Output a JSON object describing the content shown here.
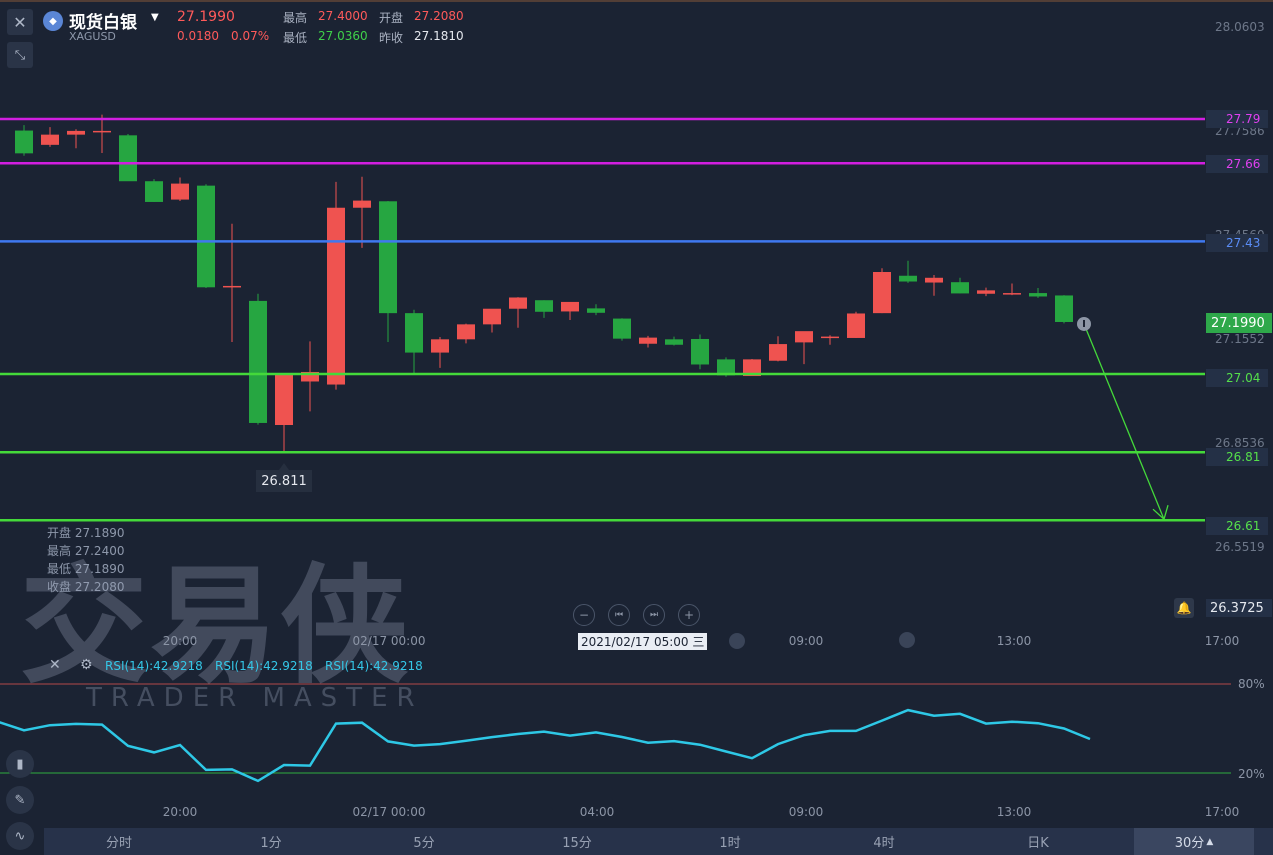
{
  "header": {
    "close_icon": "close-icon",
    "collapse_icon": "collapse-arrows-icon",
    "logo_icon": "silver-coin-icon",
    "title": "现货白银",
    "title_dropdown_icon": "caret-down-icon",
    "symbol": "XAGUSD",
    "price": "27.1990",
    "change": "0.0180",
    "change_pct": "0.07%",
    "stats": {
      "high_label": "最高",
      "high_value": "27.4000",
      "open_label": "开盘",
      "open_value": "27.2080",
      "low_label": "最低",
      "low_value": "27.0360",
      "prev_close_label": "昨收",
      "prev_close_value": "27.1810"
    }
  },
  "colors": {
    "up": "#ef5350",
    "down": "#26a641",
    "magenta_line": "#d21ee0",
    "blue_line": "#3f78f0",
    "green_line": "#44d93a",
    "rsi_line": "#2ec8e6"
  },
  "price_axis": {
    "ticks": [
      "28.0603",
      "27.7586",
      "27.4560",
      "27.1552",
      "26.8536",
      "26.5519"
    ],
    "current_price": "27.1990",
    "alarm_icon": "bell-icon",
    "alarm_price": "26.3725"
  },
  "levels": [
    {
      "price": 27.79,
      "label": "27.79",
      "color": "#d21ee0"
    },
    {
      "price": 27.66,
      "label": "27.66",
      "color": "#d21ee0"
    },
    {
      "price": 27.43,
      "label": "27.43",
      "color": "#3f78f0"
    },
    {
      "price": 27.04,
      "label": "27.04",
      "color": "#44d93a"
    },
    {
      "price": 26.81,
      "label": "26.81",
      "color": "#44d93a"
    },
    {
      "price": 26.61,
      "label": "26.61",
      "color": "#44d93a"
    }
  ],
  "chart_data": {
    "type": "candlestick",
    "timeframe": "30分",
    "x_labels": [
      "20:00",
      "02/17 00:00",
      "09:00",
      "13:00",
      "17:00"
    ],
    "candles": [
      {
        "o": 27.756,
        "h": 27.772,
        "l": 27.682,
        "c": 27.689
      },
      {
        "o": 27.714,
        "h": 27.766,
        "l": 27.708,
        "c": 27.744
      },
      {
        "o": 27.744,
        "h": 27.76,
        "l": 27.704,
        "c": 27.755
      },
      {
        "o": 27.755,
        "h": 27.803,
        "l": 27.69,
        "c": 27.755
      },
      {
        "o": 27.742,
        "h": 27.746,
        "l": 27.61,
        "c": 27.607
      },
      {
        "o": 27.607,
        "h": 27.613,
        "l": 27.546,
        "c": 27.546
      },
      {
        "o": 27.553,
        "h": 27.618,
        "l": 27.549,
        "c": 27.6
      },
      {
        "o": 27.594,
        "h": 27.598,
        "l": 27.293,
        "c": 27.295
      },
      {
        "o": 27.295,
        "h": 27.482,
        "l": 27.134,
        "c": 27.299
      },
      {
        "o": 27.255,
        "h": 27.276,
        "l": 26.891,
        "c": 26.896
      },
      {
        "o": 26.89,
        "h": 27.008,
        "l": 26.811,
        "c": 27.038
      },
      {
        "o": 27.018,
        "h": 27.136,
        "l": 26.93,
        "c": 27.046
      },
      {
        "o": 27.009,
        "h": 27.605,
        "l": 26.994,
        "c": 27.529
      },
      {
        "o": 27.529,
        "h": 27.62,
        "l": 27.411,
        "c": 27.55
      },
      {
        "o": 27.548,
        "h": 27.549,
        "l": 27.134,
        "c": 27.219
      },
      {
        "o": 27.219,
        "h": 27.229,
        "l": 27.038,
        "c": 27.103
      },
      {
        "o": 27.103,
        "h": 27.149,
        "l": 27.058,
        "c": 27.142
      },
      {
        "o": 27.142,
        "h": 27.188,
        "l": 27.13,
        "c": 27.186
      },
      {
        "o": 27.186,
        "h": 27.226,
        "l": 27.162,
        "c": 27.232
      },
      {
        "o": 27.232,
        "h": 27.266,
        "l": 27.176,
        "c": 27.265
      },
      {
        "o": 27.257,
        "h": 27.257,
        "l": 27.205,
        "c": 27.223
      },
      {
        "o": 27.224,
        "h": 27.248,
        "l": 27.199,
        "c": 27.252
      },
      {
        "o": 27.233,
        "h": 27.245,
        "l": 27.213,
        "c": 27.22
      },
      {
        "o": 27.203,
        "h": 27.204,
        "l": 27.138,
        "c": 27.144
      },
      {
        "o": 27.129,
        "h": 27.152,
        "l": 27.118,
        "c": 27.147
      },
      {
        "o": 27.142,
        "h": 27.15,
        "l": 27.124,
        "c": 27.126
      },
      {
        "o": 27.143,
        "h": 27.156,
        "l": 27.054,
        "c": 27.068
      },
      {
        "o": 27.083,
        "h": 27.089,
        "l": 27.032,
        "c": 27.036
      },
      {
        "o": 27.034,
        "h": 27.084,
        "l": 27.034,
        "c": 27.083
      },
      {
        "o": 27.079,
        "h": 27.151,
        "l": 27.077,
        "c": 27.128
      },
      {
        "o": 27.133,
        "h": 27.164,
        "l": 27.069,
        "c": 27.166
      },
      {
        "o": 27.147,
        "h": 27.154,
        "l": 27.126,
        "c": 27.15
      },
      {
        "o": 27.146,
        "h": 27.223,
        "l": 27.146,
        "c": 27.218
      },
      {
        "o": 27.219,
        "h": 27.351,
        "l": 27.219,
        "c": 27.34
      },
      {
        "o": 27.329,
        "h": 27.373,
        "l": 27.308,
        "c": 27.312
      },
      {
        "o": 27.309,
        "h": 27.331,
        "l": 27.27,
        "c": 27.323
      },
      {
        "o": 27.31,
        "h": 27.323,
        "l": 27.277,
        "c": 27.277
      },
      {
        "o": 27.276,
        "h": 27.294,
        "l": 27.269,
        "c": 27.286
      },
      {
        "o": 27.277,
        "h": 27.306,
        "l": 27.272,
        "c": 27.278
      },
      {
        "o": 27.278,
        "h": 27.293,
        "l": 27.264,
        "c": 27.268
      },
      {
        "o": 27.271,
        "h": 27.272,
        "l": 27.189,
        "c": 27.193
      }
    ],
    "price_range": [
      26.4,
      28.08
    ],
    "last_marker": "info-icon",
    "low_annotation": "26.811",
    "projection": {
      "from_price": 27.193,
      "to_price": 26.61
    }
  },
  "ohlc_tooltip": {
    "open_label": "开盘",
    "open_value": "27.1890",
    "high_label": "最高",
    "high_value": "27.2400",
    "low_label": "最低",
    "low_value": "27.1890",
    "close_label": "收盘",
    "close_value": "27.2080"
  },
  "crosshair": {
    "date": "2021/02/17 05:00",
    "weekday": "三"
  },
  "nav_icons": [
    "zoom-out-icon",
    "step-back-icon",
    "step-forward-icon",
    "zoom-in-icon"
  ],
  "watermark": {
    "text": "交易侠",
    "subtext": "TRADER MASTER"
  },
  "rsi": {
    "label": "RSI(14):42.9218",
    "levels": [
      "80%",
      "20%"
    ],
    "range": [
      0,
      100
    ],
    "values": [
      54.5,
      48.8,
      52.2,
      53.1,
      52.6,
      38.3,
      33.9,
      38.9,
      22.1,
      22.4,
      14.7,
      25.4,
      25.0,
      53.3,
      53.9,
      41.3,
      38.5,
      39.5,
      41.8,
      44.2,
      46.3,
      47.9,
      45.2,
      47.4,
      44.3,
      40.4,
      41.5,
      39.1,
      34.5,
      30.0,
      39.5,
      45.5,
      48.4,
      48.4,
      55.3,
      62.4,
      58.6,
      59.9,
      53.3,
      54.6,
      53.6,
      50.0,
      42.9
    ],
    "x_labels": [
      "20:00",
      "02/17 00:00",
      "04:00",
      "09:00",
      "13:00",
      "17:00"
    ]
  },
  "side_tools": [
    "candlestick-icon",
    "pencil-icon",
    "indicator-icon"
  ],
  "timeframe_tabs": [
    "分时",
    "1分",
    "5分",
    "15分",
    "1时",
    "4时",
    "日K",
    "30分"
  ],
  "active_tab_caret": "caret-up-icon"
}
